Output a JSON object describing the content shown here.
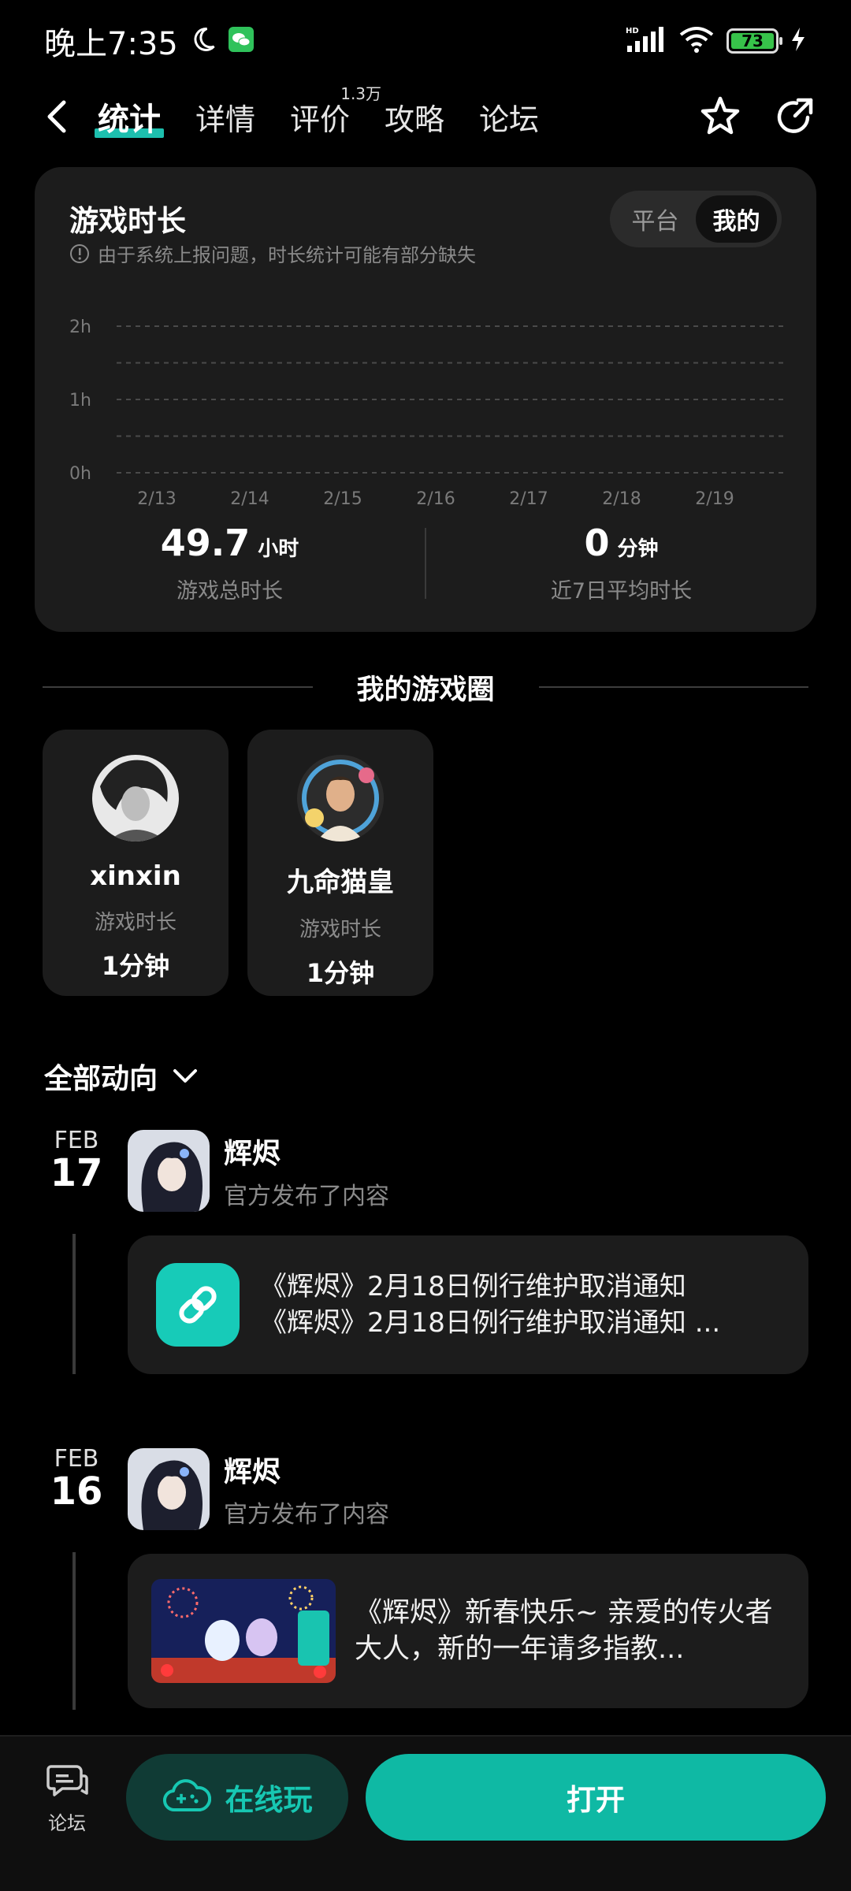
{
  "status_bar": {
    "time": "晚上7:35",
    "battery": "73",
    "network": "HD"
  },
  "nav": {
    "tabs": [
      {
        "label": "统计",
        "active": true
      },
      {
        "label": "详情",
        "active": false
      },
      {
        "label": "评价",
        "badge": "1.3万",
        "active": false
      },
      {
        "label": "攻略",
        "active": false
      },
      {
        "label": "论坛",
        "active": false
      }
    ]
  },
  "stats": {
    "title": "游戏时长",
    "note": "由于系统上报问题，时长统计可能有部分缺失",
    "toggle": {
      "options": [
        "平台",
        "我的"
      ],
      "selected": "我的"
    },
    "total_value": "49.7",
    "total_unit": "小时",
    "total_label": "游戏总时长",
    "avg_value": "0",
    "avg_unit": "分钟",
    "avg_label": "近7日平均时长"
  },
  "chart_data": {
    "type": "bar",
    "categories": [
      "2/13",
      "2/14",
      "2/15",
      "2/16",
      "2/17",
      "2/18",
      "2/19"
    ],
    "values": [
      0,
      0,
      0,
      0,
      0,
      0,
      0
    ],
    "y_ticks": [
      "0h",
      "1h",
      "2h"
    ],
    "ylim": [
      0,
      2
    ],
    "grid": true,
    "title": "",
    "xlabel": "",
    "ylabel": ""
  },
  "game_circle": {
    "title": "我的游戏圈",
    "friends": [
      {
        "name": "xinxin",
        "label": "游戏时长",
        "value": "1分钟"
      },
      {
        "name": "九命猫皇",
        "label": "游戏时长",
        "value": "1分钟"
      }
    ]
  },
  "activity": {
    "filter_label": "全部动向",
    "posts": [
      {
        "month": "FEB",
        "day": "17",
        "author": "辉烬",
        "action": "官方发布了内容",
        "lines": [
          "《辉烬》2月18日例行维护取消通知",
          "《辉烬》2月18日例行维护取消通知 ..."
        ]
      },
      {
        "month": "FEB",
        "day": "16",
        "author": "辉烬",
        "action": "官方发布了内容",
        "text": "《辉烬》新春快乐~ 亲爱的传火者大人，新的一年请多指教..."
      }
    ]
  },
  "bottom": {
    "forum_label": "论坛",
    "cloud_play_label": "在线玩",
    "open_label": "打开"
  },
  "colors": {
    "accent": "#17c7b2",
    "card_bg": "#1c1c1c",
    "background": "#000000"
  }
}
